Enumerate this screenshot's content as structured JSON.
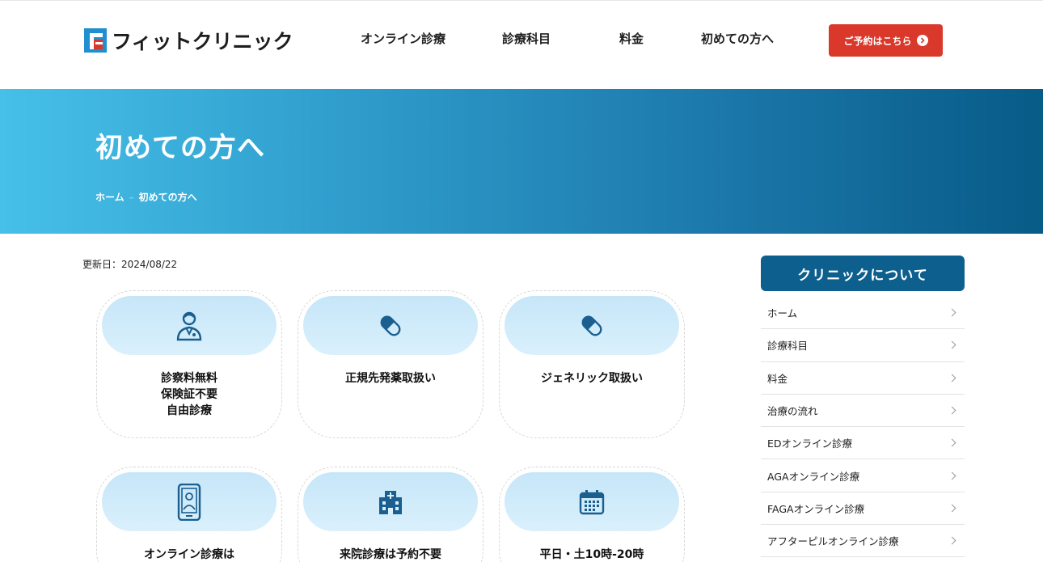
{
  "header": {
    "logo_text": "フィットクリニック",
    "nav": [
      "オンライン診療",
      "診療科目",
      "料金",
      "初めての方へ"
    ],
    "reserve_label": "ご予約はこちら"
  },
  "hero": {
    "title": "初めての方へ",
    "breadcrumb": {
      "home": "ホーム",
      "sep": "–",
      "current": "初めての方へ"
    }
  },
  "main": {
    "updated": "更新日：2024/08/22",
    "cards": [
      {
        "icon": "doctor-icon",
        "lines": [
          "診察料無料",
          "保険証不要",
          "自由診療"
        ]
      },
      {
        "icon": "capsule-icon",
        "lines": [
          "正規先発薬取扱い"
        ]
      },
      {
        "icon": "capsule-icon",
        "lines": [
          "ジェネリック取扱い"
        ]
      },
      {
        "icon": "smartphone-icon",
        "lines": [
          "オンライン診療は"
        ]
      },
      {
        "icon": "hospital-icon",
        "lines": [
          "来院診療は予約不要"
        ]
      },
      {
        "icon": "calendar-icon",
        "lines": [
          "平日・土10時-20時"
        ]
      }
    ]
  },
  "sidebar": {
    "heading": "クリニックについて",
    "items": [
      "ホーム",
      "診療科目",
      "料金",
      "治療の流れ",
      "EDオンライン診療",
      "AGAオンライン診療",
      "FAGAオンライン診療",
      "アフターピルオンライン診療"
    ]
  },
  "colors": {
    "accent_blue": "#0d5f8e",
    "reserve_red": "#d9382a",
    "icon_blue": "#1a5f8f"
  }
}
